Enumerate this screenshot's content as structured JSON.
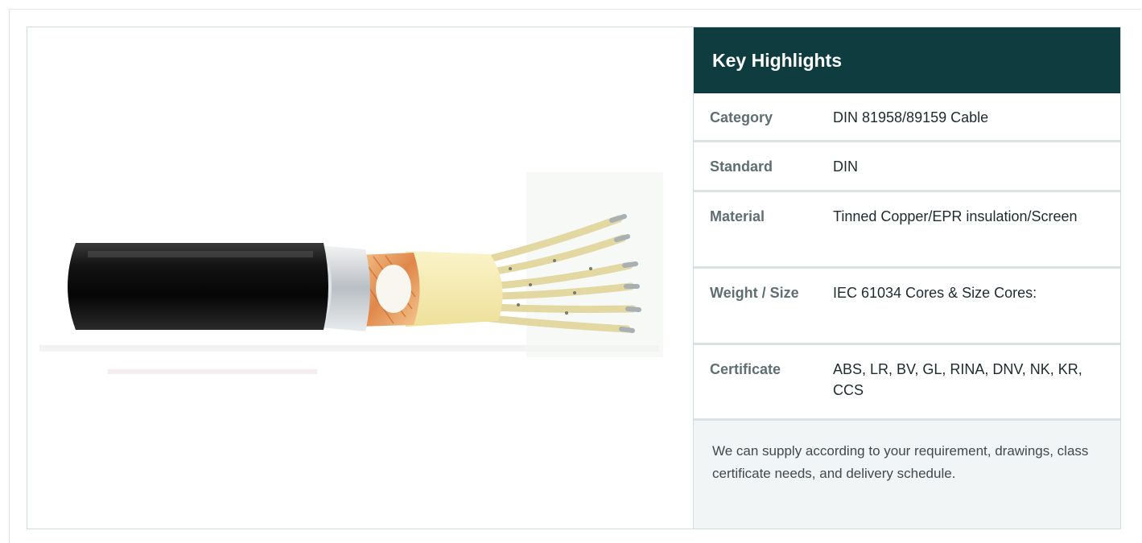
{
  "product": {
    "image_alt": "DIN 81958/89159 cable",
    "colors": {
      "header_bg": "#0f3d3f",
      "label_text": "#5f6e71",
      "note_bg": "#f1f5f5"
    }
  },
  "highlights": {
    "title": "Key Highlights",
    "rows": [
      {
        "label": "Category",
        "value": "DIN 81958/89159 Cable"
      },
      {
        "label": "Standard",
        "value": "DIN"
      },
      {
        "label": "Material",
        "value": "Tinned Copper/EPR insulation/Screen"
      },
      {
        "label": "Weight / Size",
        "value": "IEC 61034 Cores & Size Cores:"
      },
      {
        "label": "Certificate",
        "value": "ABS, LR, BV, GL, RINA, DNV, NK, KR, CCS"
      }
    ],
    "note": "We can supply according to your requirement, drawings, class certificate needs, and delivery schedule."
  }
}
